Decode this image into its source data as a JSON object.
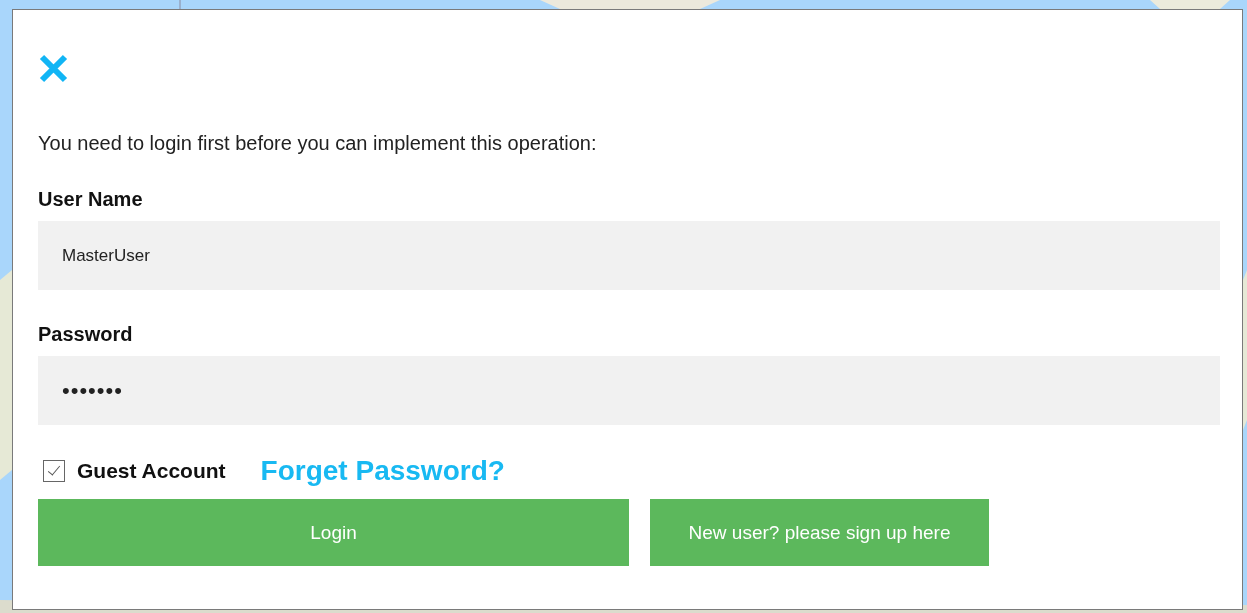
{
  "dialog": {
    "message": "You need to login first before you can implement this operation:",
    "fields": [
      {
        "label": "User Name",
        "value": "MasterUser",
        "kind": "text"
      },
      {
        "label": "Password",
        "value": "•••••••",
        "kind": "password"
      }
    ],
    "guest": {
      "label": "Guest Account",
      "checked": true
    },
    "forgot_link": "Forget Password?",
    "buttons": [
      {
        "label": "Login",
        "kind": "wide"
      },
      {
        "label": "New user? please sign up here",
        "kind": "narrow"
      }
    ]
  }
}
